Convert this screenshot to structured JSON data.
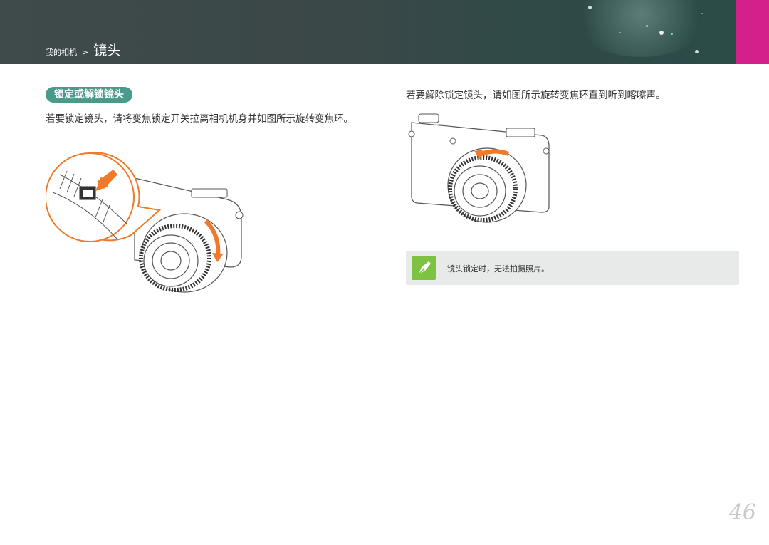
{
  "header": {
    "breadcrumb_parent": "我的相机",
    "breadcrumb_sep": ">",
    "breadcrumb_current": "镜头",
    "accent_color": "#d4218a",
    "bg_color": "#3b4848"
  },
  "section": {
    "title": "锁定或解锁镜头",
    "color": "#4a9a8c"
  },
  "left": {
    "text": "若要锁定镜头，请将变焦锁定开关拉离相机机身并如图所示旋转变焦环。",
    "illustration": "camera-lock-lens-illustration"
  },
  "right": {
    "text": "若要解除锁定镜头，请如图所示旋转变焦环直到听到喀嚓声。",
    "illustration": "camera-unlock-lens-illustration"
  },
  "note": {
    "icon": "pen-icon",
    "text": "镜头锁定时，无法拍摄照片。",
    "icon_color": "#7dc242"
  },
  "page": {
    "number": "46"
  }
}
